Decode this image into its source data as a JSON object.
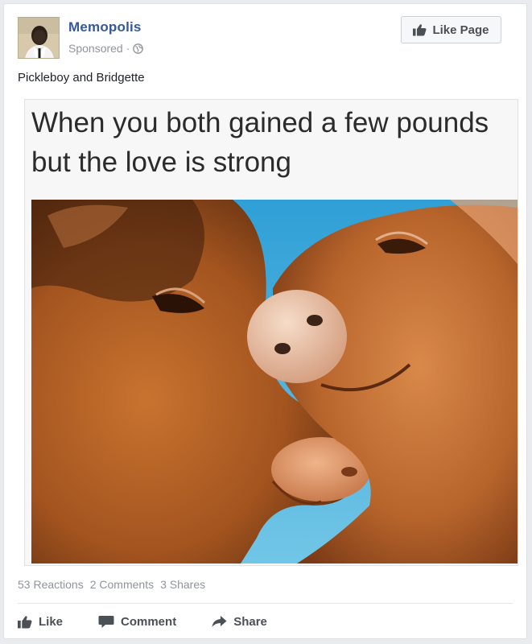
{
  "post": {
    "page_name": "Memopolis",
    "sponsored": "Sponsored",
    "dot": "·",
    "like_page_label": "Like Page",
    "text": "Pickleboy and Bridgette"
  },
  "meme": {
    "caption": "When you both gained a few pounds but the love is strong"
  },
  "stats": {
    "reactions": "53 Reactions",
    "comments": "2 Comments",
    "shares": "3 Shares"
  },
  "actions": {
    "like": "Like",
    "comment": "Comment",
    "share": "Share"
  },
  "icons": {
    "globe": "globe-icon",
    "thumbs_up": "thumbs-up-icon",
    "comment": "comment-icon",
    "share": "share-arrow-icon"
  },
  "colors": {
    "page_name": "#365899",
    "secondary_text": "#90949c",
    "button_text": "#4b4f56"
  }
}
